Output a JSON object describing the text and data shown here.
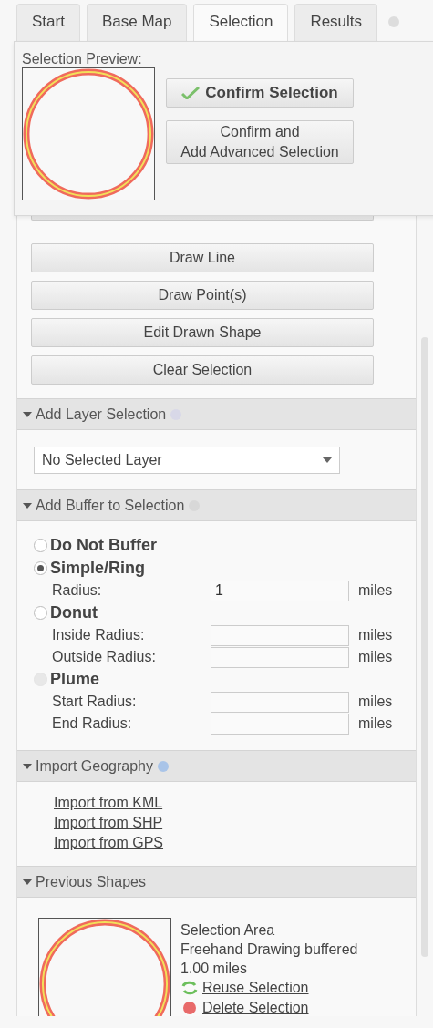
{
  "tabs": [
    {
      "label": "Start",
      "selected": false
    },
    {
      "label": "Base Map",
      "selected": false
    },
    {
      "label": "Selection",
      "selected": true
    },
    {
      "label": "Results",
      "selected": false
    }
  ],
  "preview_popup": {
    "title": "Selection Preview:",
    "buttons": [
      {
        "label": "Confirm Selection",
        "kind": "confirm"
      },
      {
        "label": "Confirm and\nAdd Advanced Selection",
        "kind": "plain"
      }
    ]
  },
  "draw_buttons": [
    "Draw Line",
    "Draw Point(s)",
    "Edit Drawn Shape",
    "Clear Selection"
  ],
  "layer_section": {
    "title": "Add Layer Selection",
    "help_icon": true,
    "select_value": "No Selected Layer"
  },
  "buffer_section": {
    "title": "Add Buffer to Selection",
    "help_icon": true,
    "options": [
      {
        "label": "Do Not Buffer",
        "selected": false,
        "disabled": false
      },
      {
        "label": "Simple/Ring",
        "selected": true,
        "disabled": false,
        "fields": [
          {
            "label": "Radius:",
            "value": "1",
            "unit": "miles"
          }
        ]
      },
      {
        "label": "Donut",
        "selected": false,
        "disabled": false,
        "fields": [
          {
            "label": "Inside Radius:",
            "unit": "miles"
          },
          {
            "label": "Outside Radius:",
            "unit": "miles"
          }
        ]
      },
      {
        "label": "Plume",
        "selected": false,
        "disabled": true,
        "fields": [
          {
            "label": "Start Radius:",
            "unit": "miles"
          },
          {
            "label": "End Radius:",
            "unit": "miles"
          }
        ]
      }
    ]
  },
  "import_section": {
    "title": "Import Geography",
    "help_icon": true,
    "links": [
      "Import from KML",
      "Import from SHP",
      "Import from GPS"
    ]
  },
  "previous_section": {
    "title": "Previous Shapes",
    "help_icon": false,
    "items": [
      {
        "title": "Selection Area",
        "description": "Freehand Drawing buffered",
        "distance": "1.00 miles",
        "reuse": "Reuse Selection",
        "delete": "Delete Selection"
      }
    ]
  }
}
